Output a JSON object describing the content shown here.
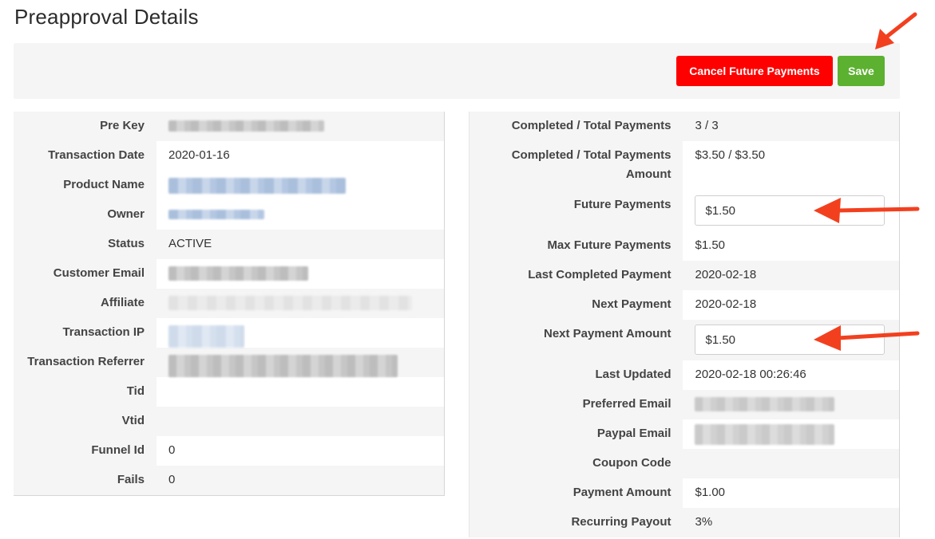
{
  "page": {
    "title": "Preapproval Details"
  },
  "toolbar": {
    "cancel_label": "Cancel Future Payments",
    "save_label": "Save",
    "cancel_color": "#ff0000",
    "save_color": "#5cb130"
  },
  "left_fields": [
    {
      "label": "Pre Key",
      "value": ""
    },
    {
      "label": "Transaction Date",
      "value": "2020-01-16"
    },
    {
      "label": "Product Name",
      "value": ""
    },
    {
      "label": "Owner",
      "value": ""
    },
    {
      "label": "Status",
      "value": "ACTIVE"
    },
    {
      "label": "Customer Email",
      "value": ""
    },
    {
      "label": "Affiliate",
      "value": ""
    },
    {
      "label": "Transaction IP",
      "value": ""
    },
    {
      "label": "Transaction Referrer",
      "value": ""
    },
    {
      "label": "Tid",
      "value": ""
    },
    {
      "label": "Vtid",
      "value": ""
    },
    {
      "label": "Funnel Id",
      "value": "0"
    },
    {
      "label": "Fails",
      "value": "0"
    }
  ],
  "right_fields": {
    "completed_total": {
      "label": "Completed / Total Payments",
      "value": "3 / 3"
    },
    "completed_total_amount": {
      "label_line1": "Completed / Total Payments",
      "label_line2": "Amount",
      "value": "$3.50 / $3.50"
    },
    "future_payments": {
      "label": "Future Payments",
      "value": "$1.50"
    },
    "max_future_payments": {
      "label": "Max Future Payments",
      "value": "$1.50"
    },
    "last_completed_payment": {
      "label": "Last Completed Payment",
      "value": "2020-02-18"
    },
    "next_payment": {
      "label": "Next Payment",
      "value": "2020-02-18"
    },
    "next_payment_amount": {
      "label": "Next Payment Amount",
      "value": "$1.50"
    },
    "last_updated": {
      "label": "Last Updated",
      "value": "2020-02-18 00:26:46"
    },
    "preferred_email": {
      "label": "Preferred Email",
      "value": ""
    },
    "paypal_email": {
      "label": "Paypal Email",
      "value": ""
    },
    "coupon_code": {
      "label": "Coupon Code",
      "value": ""
    },
    "payment_amount": {
      "label": "Payment Amount",
      "value": "$1.00"
    },
    "recurring_payout": {
      "label": "Recurring Payout",
      "value": "3%"
    }
  },
  "annotations": {
    "arrow_color": "#f2401f",
    "arrow_icon": "red-arrow-icon"
  }
}
